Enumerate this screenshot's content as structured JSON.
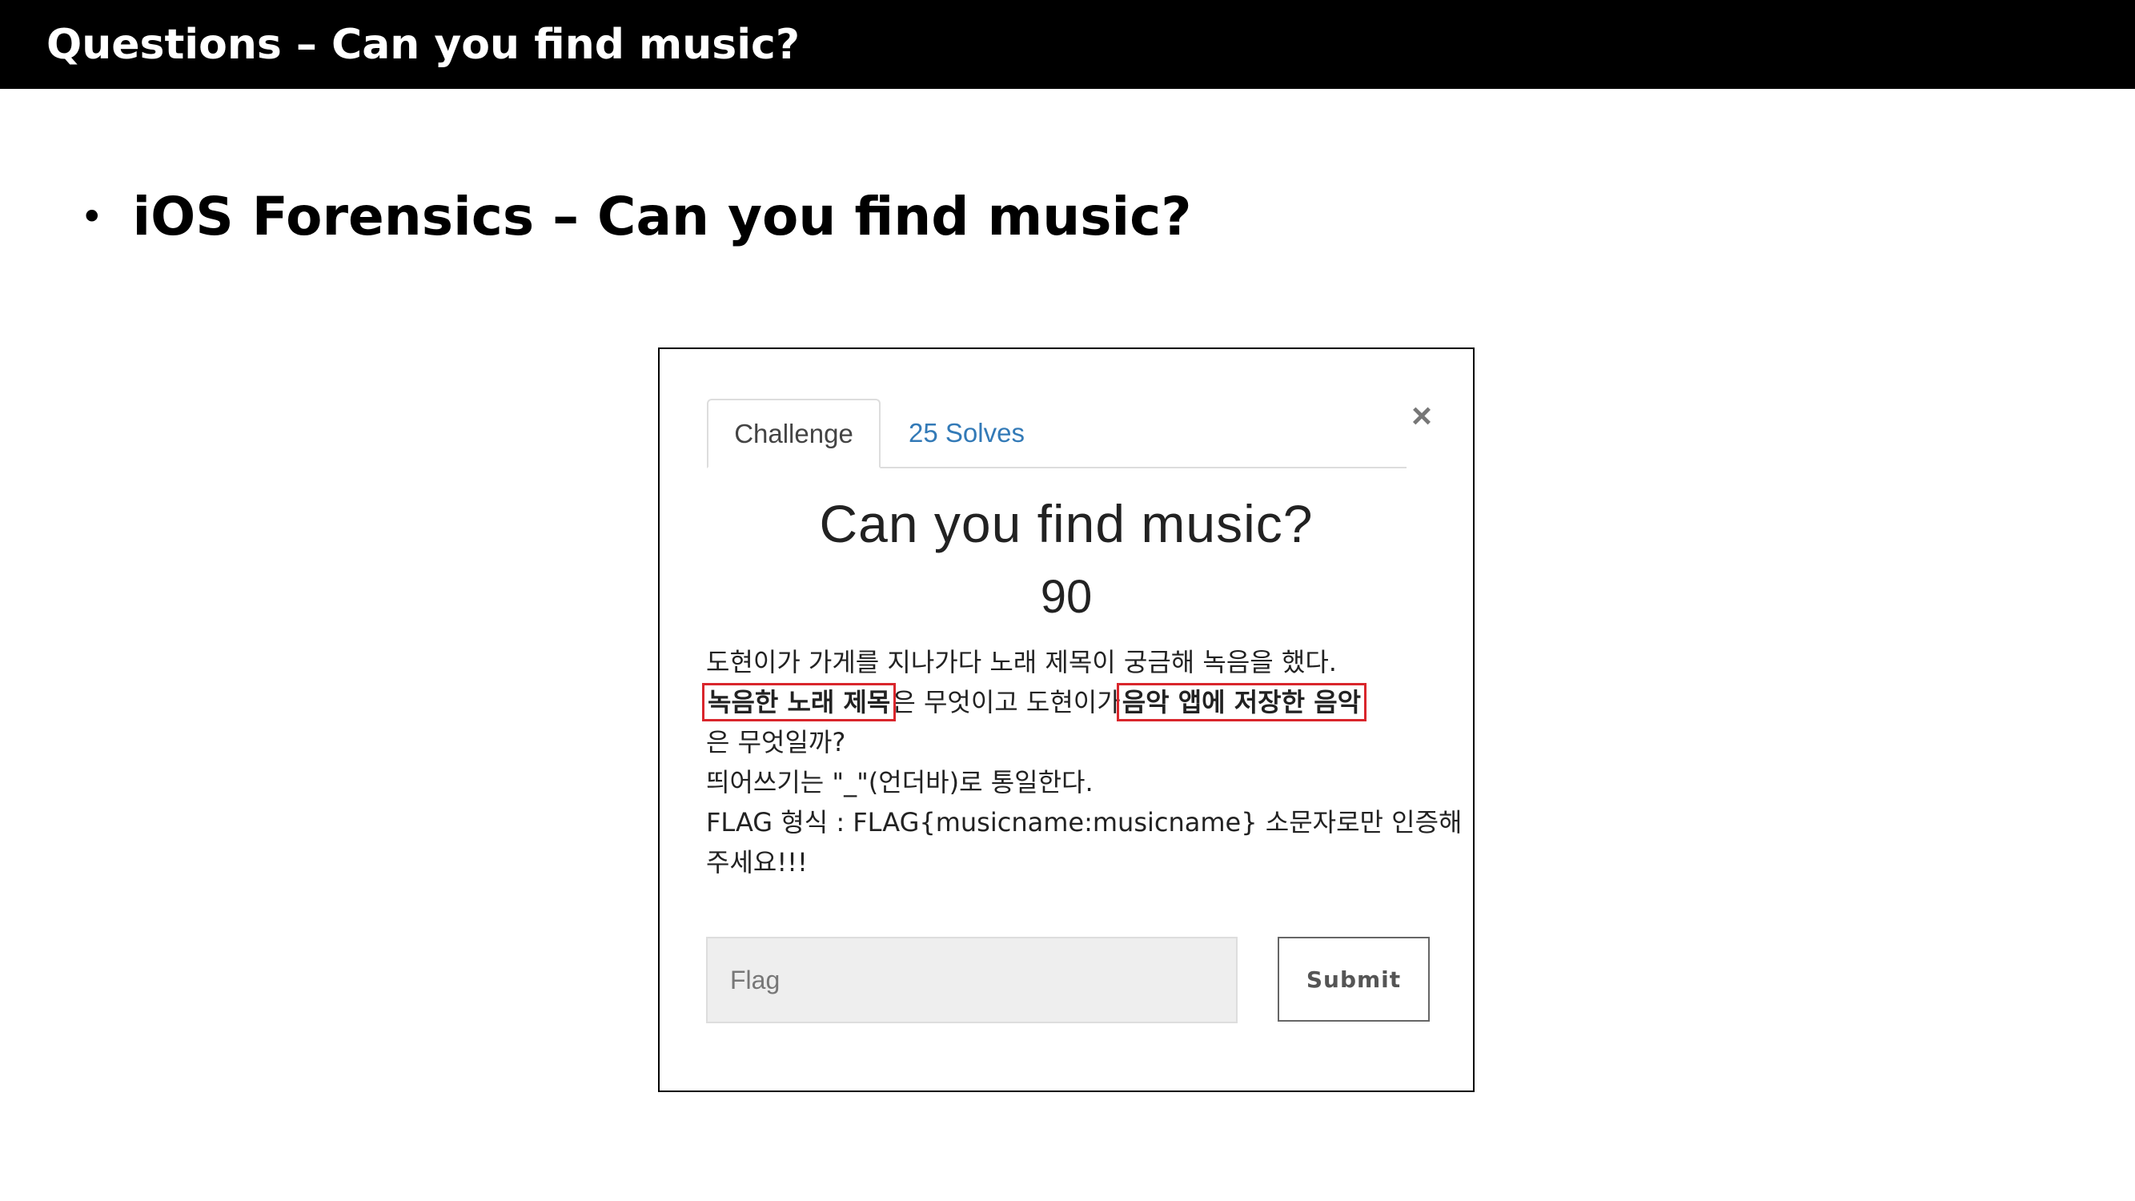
{
  "slide": {
    "title": "Questions – Can you find music?",
    "bullet": "iOS Forensics – Can you find music?"
  },
  "modal": {
    "tabs": [
      {
        "label": "Challenge",
        "active": true
      },
      {
        "label": "25 Solves",
        "active": false
      }
    ],
    "close_label": "×",
    "challenge_name": "Can you find music?",
    "challenge_value": "90",
    "description": {
      "line1": "도현이가 가게를 지나가다 노래 제목이 궁금해 녹음을 했다.",
      "line2_hl1": "녹음한 노래 제목",
      "line2_mid": "은 무엇이고 도현이가",
      "line2_hl2": "음악 앱에 저장한 음악",
      "line3": "은 무엇일까?",
      "line4": "띄어쓰기는 \"_\"(언더바)로 통일한다.",
      "line5": "FLAG 형식 : FLAG{musicname:musicname} 소문자로만 인증해",
      "line6": "주세요!!!"
    },
    "flag_input": {
      "placeholder": "Flag",
      "value": ""
    },
    "submit_label": "Submit"
  },
  "colors": {
    "title_bar_bg": "#000000",
    "link": "#337ab7",
    "highlight_box": "#d9262c"
  }
}
